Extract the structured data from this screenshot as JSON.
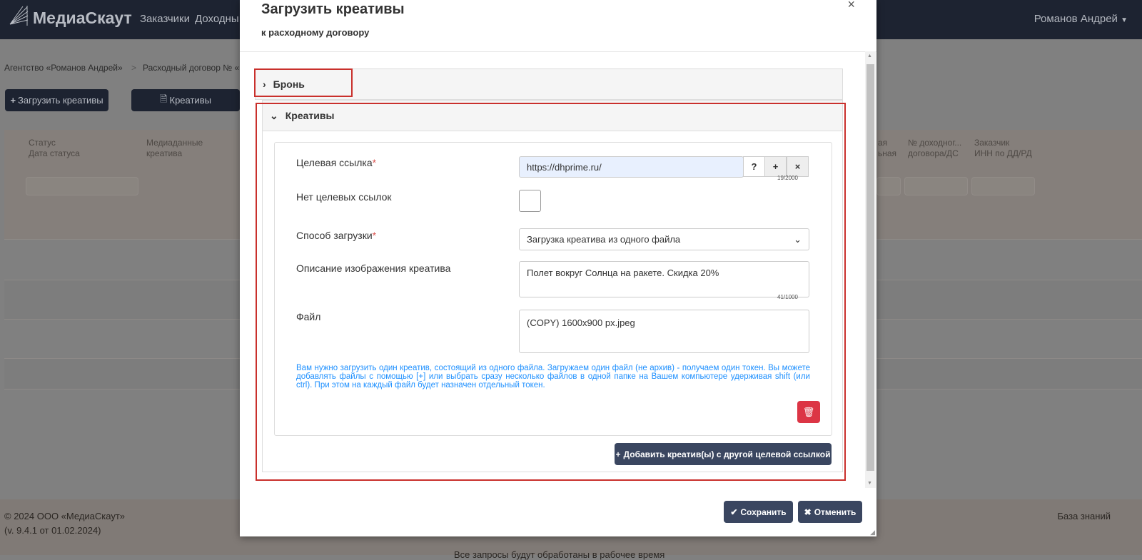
{
  "nav": {
    "brand": "МедиаСкаут",
    "links": [
      "Заказчики",
      "Доходны"
    ],
    "user": "Романов Андрей"
  },
  "breadcrumb": [
    "Агентство «Романов Андрей»",
    "Расходный договор № «"
  ],
  "page_buttons": {
    "upload": "Загрузить креативы",
    "creatives": "Креативы"
  },
  "table_headers": [
    [
      "Статус",
      "Дата статуса"
    ],
    [
      "Медиаданные",
      "креатива"
    ],
    [
      "ая",
      "ьная"
    ],
    [
      "№ доходног...",
      "договора/ДС"
    ],
    [
      "Заказчик",
      "ИНН по ДД/РД"
    ]
  ],
  "footer": {
    "copyright": "© 2024 ООО «МедиаСкаут»",
    "version": "(v. 9.4.1 от 01.02.2024)",
    "kb": "База знаний",
    "note": "Все запросы будут обработаны в рабочее время"
  },
  "modal": {
    "title": "Загрузить креативы",
    "subtitle": "к расходному договору",
    "close": "×",
    "bron": "Бронь",
    "creatives": "Креативы",
    "form": {
      "target_label": "Целевая ссылка",
      "target_value": "https://dhprime.ru/",
      "target_count": "19/2000",
      "help": "?",
      "add": "+",
      "clear": "×",
      "no_links_label": "Нет целевых ссылок",
      "method_label": "Способ загрузки",
      "method_value": "Загрузка креатива из одного файла",
      "desc_label": "Описание изображения креатива",
      "desc_value": "Полет вокруг Солнца на ракете. Скидка 20%",
      "desc_count": "41/1000",
      "file_label": "Файл",
      "file_value": "(COPY) 1600x900 px.jpeg",
      "hint": "Вам нужно загрузить один креатив, состоящий из одного файла. Загружаем один файл (не архив) - получаем один токен. Вы можете добавлять файлы с помощью [+] или выбрать сразу несколько файлов в одной папке на Вашем компьютере удерживая shift (или ctrl). При этом на каждый файл будет назначен отдельный токен."
    },
    "add_other": "Добавить креатив(ы) с другой целевой ссылкой",
    "save": "Сохранить",
    "cancel": "Отменить"
  }
}
